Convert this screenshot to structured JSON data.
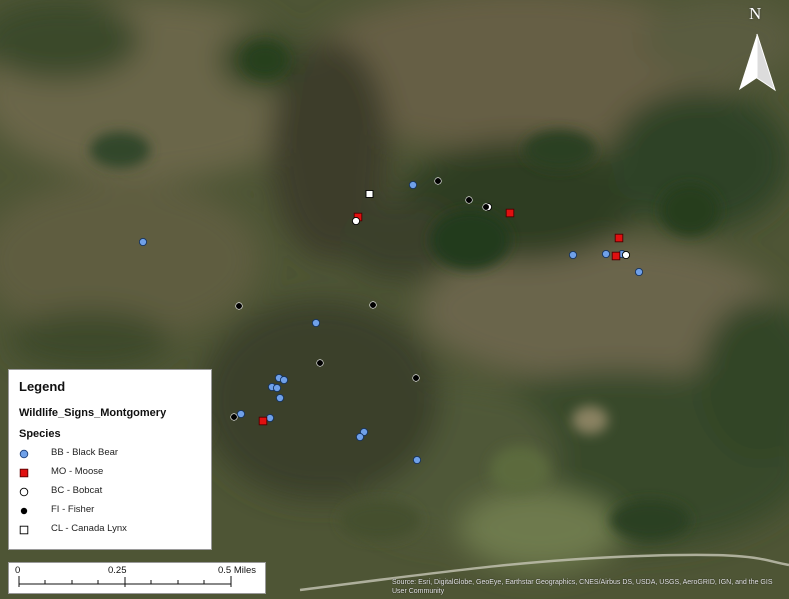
{
  "map": {
    "north_label": "N",
    "colors": {
      "black_bear": "#6fa0e8",
      "moose": "#e01010",
      "bobcat": "#ffffff",
      "fisher": "#000000",
      "lynx": "#ffffff"
    }
  },
  "legend": {
    "title": "Legend",
    "layer": "Wildlife_Signs_Montgomery",
    "species_heading": "Species",
    "items": [
      {
        "label": "BB - Black Bear",
        "symbol": "circle-blue"
      },
      {
        "label": "MO - Moose",
        "symbol": "square-red"
      },
      {
        "label": "BC - Bobcat",
        "symbol": "circle-white"
      },
      {
        "label": "FI - Fisher",
        "symbol": "circle-black"
      },
      {
        "label": "CL - Canada Lynx",
        "symbol": "square-white"
      }
    ]
  },
  "scalebar": {
    "labels": [
      "0",
      "0.25",
      "0.5 Miles"
    ]
  },
  "credits": "Source: Esri, DigitalGlobe, GeoEye, Earthstar Geographics, CNES/Airbus DS, USDA, USGS, AeroGRID, IGN, and the GIS User Community"
}
